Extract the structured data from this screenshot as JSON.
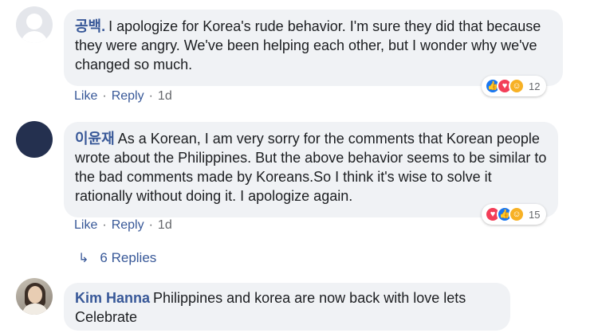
{
  "comments": [
    {
      "author": "공백.",
      "text": "I apologize for Korea's rude behavior. I'm sure they did that because they were angry. We've been helping each other, but I wonder why we've changed so much.",
      "reactions": {
        "icons": [
          "like-icon",
          "love-icon",
          "care-icon"
        ],
        "count": "12"
      },
      "actions": {
        "like": "Like",
        "reply": "Reply",
        "time": "1d"
      }
    },
    {
      "author": "이윤재",
      "text": "As a Korean, I am very sorry for the comments that Korean people wrote about the Philippines. But the above behavior seems to be similar to the bad comments made by Koreans.So I think it's wise to solve it rationally without doing it. I apologize again.",
      "reactions": {
        "icons": [
          "love-icon",
          "like-icon",
          "care-icon"
        ],
        "count": "15"
      },
      "actions": {
        "like": "Like",
        "reply": "Reply",
        "time": "1d"
      }
    },
    {
      "author": "Kim Hanna",
      "text": "Philippines and korea are now back with love lets Celebrate"
    }
  ],
  "replies_link": {
    "label": "6 Replies"
  },
  "separator": "·",
  "colors": {
    "link": "#385898",
    "bubble": "#f0f2f5",
    "meta": "#65676b",
    "like": "#1877f2",
    "love": "#f33e58",
    "care": "#f7b125"
  }
}
